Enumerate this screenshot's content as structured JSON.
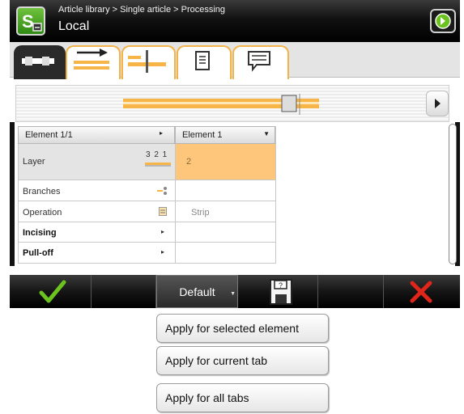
{
  "header": {
    "breadcrumb": "Article library > Single article > Processing",
    "title": "Local",
    "logo_text": "S",
    "next_icon": "arrow-right-circle-icon"
  },
  "tabs": [
    {
      "name": "element-overview",
      "active": true
    },
    {
      "name": "forward-arrow",
      "active": false
    },
    {
      "name": "branch",
      "active": false
    },
    {
      "name": "document",
      "active": false
    },
    {
      "name": "message",
      "active": false
    }
  ],
  "table": {
    "header_left": "Element 1/1",
    "header_right": "Element 1",
    "rows": [
      {
        "label": "Layer",
        "value": "2",
        "icon_text": "3 2 1"
      },
      {
        "label": "Branches",
        "value": ""
      },
      {
        "label": "Operation",
        "value": "Strip"
      },
      {
        "label": "Incising",
        "value": ""
      },
      {
        "label": "Pull-off",
        "value": ""
      }
    ]
  },
  "toolbar": {
    "default_label": "Default",
    "confirm_icon": "checkmark-icon",
    "save_icon": "save-icon",
    "cancel_icon": "close-icon"
  },
  "menu": {
    "items": [
      "Apply for selected element",
      "Apply for current tab",
      "Apply for all tabs"
    ]
  },
  "colors": {
    "accent": "#f7b548",
    "highlight_row": "#fdc67a",
    "confirm": "#6cc21f",
    "cancel": "#e0251b",
    "header_bg": "#000000"
  }
}
